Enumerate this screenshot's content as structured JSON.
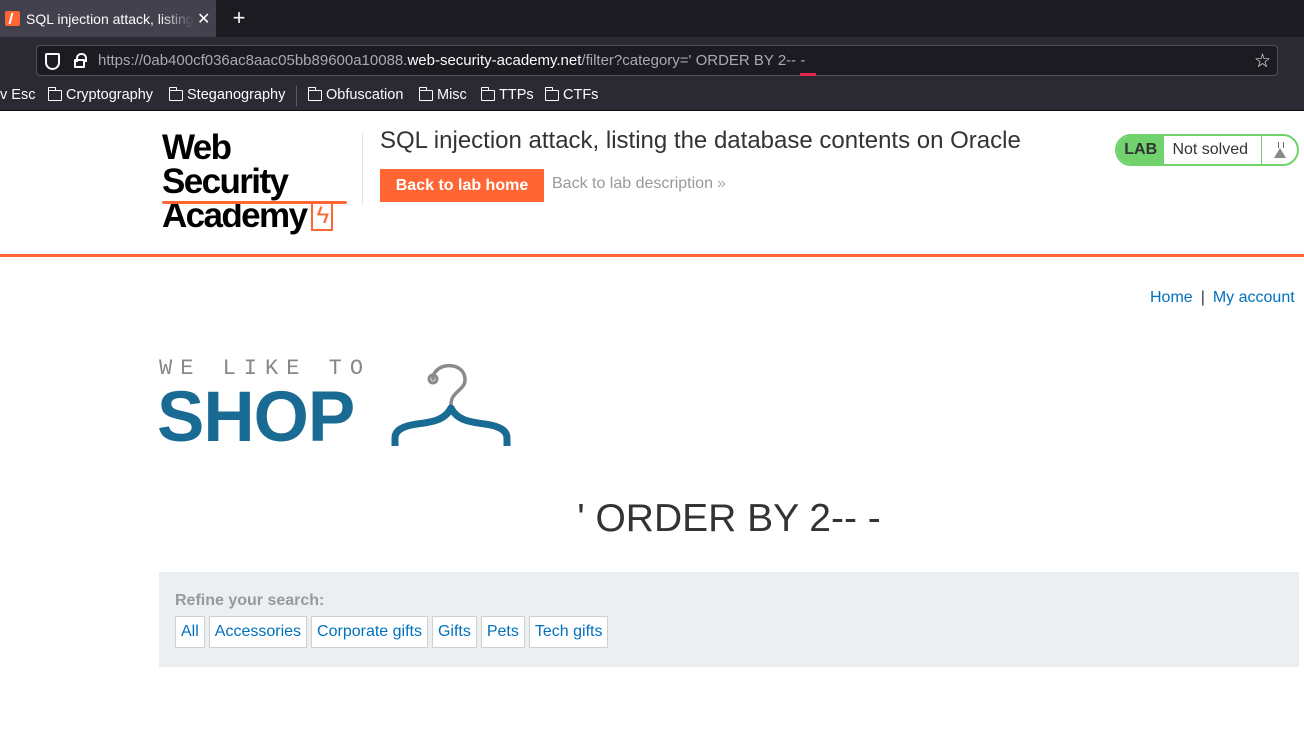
{
  "browser": {
    "tab_title": "SQL injection attack, listing the database contents on Oracle",
    "tab_close": "✕",
    "new_tab": "+",
    "url_prefix": "https://0ab400cf036ac8aac05bb89600a10088.",
    "url_host": "web-security-academy.net",
    "url_path": "/filter?category=' ORDER BY 2-- -",
    "bookmarks": [
      {
        "label": "v Esc",
        "folder": false
      },
      {
        "label": "Cryptography",
        "folder": true
      },
      {
        "label": "Steganography",
        "folder": true
      },
      {
        "label": "Obfuscation",
        "folder": true
      },
      {
        "label": "Misc",
        "folder": true
      },
      {
        "label": "TTPs",
        "folder": true
      },
      {
        "label": "CTFs",
        "folder": true
      }
    ],
    "icons": [
      "shield-icon",
      "lock-icon",
      "star-icon",
      "folder-icon"
    ]
  },
  "academy": {
    "logo_line1": "Web Security",
    "logo_line2": "Academy",
    "lab_title": "SQL injection attack, listing the database contents on Oracle",
    "back_home": "Back to lab home",
    "back_description": "Back to lab description",
    "status_badge": "LAB",
    "status_text": "Not solved",
    "accent": "#ff6633",
    "status_color": "#70d16d"
  },
  "shop": {
    "nav": {
      "home": "Home",
      "separator": "|",
      "account": "My account"
    },
    "logo_tagline": "WE LIKE TO",
    "logo_word": "SHOP",
    "heading": "' ORDER BY 2-- -",
    "filter_label": "Refine your search:",
    "categories": [
      "All",
      "Accessories",
      "Corporate gifts",
      "Gifts",
      "Pets",
      "Tech gifts"
    ],
    "brand_color": "#1a6b94",
    "link_color": "#0071bc"
  }
}
